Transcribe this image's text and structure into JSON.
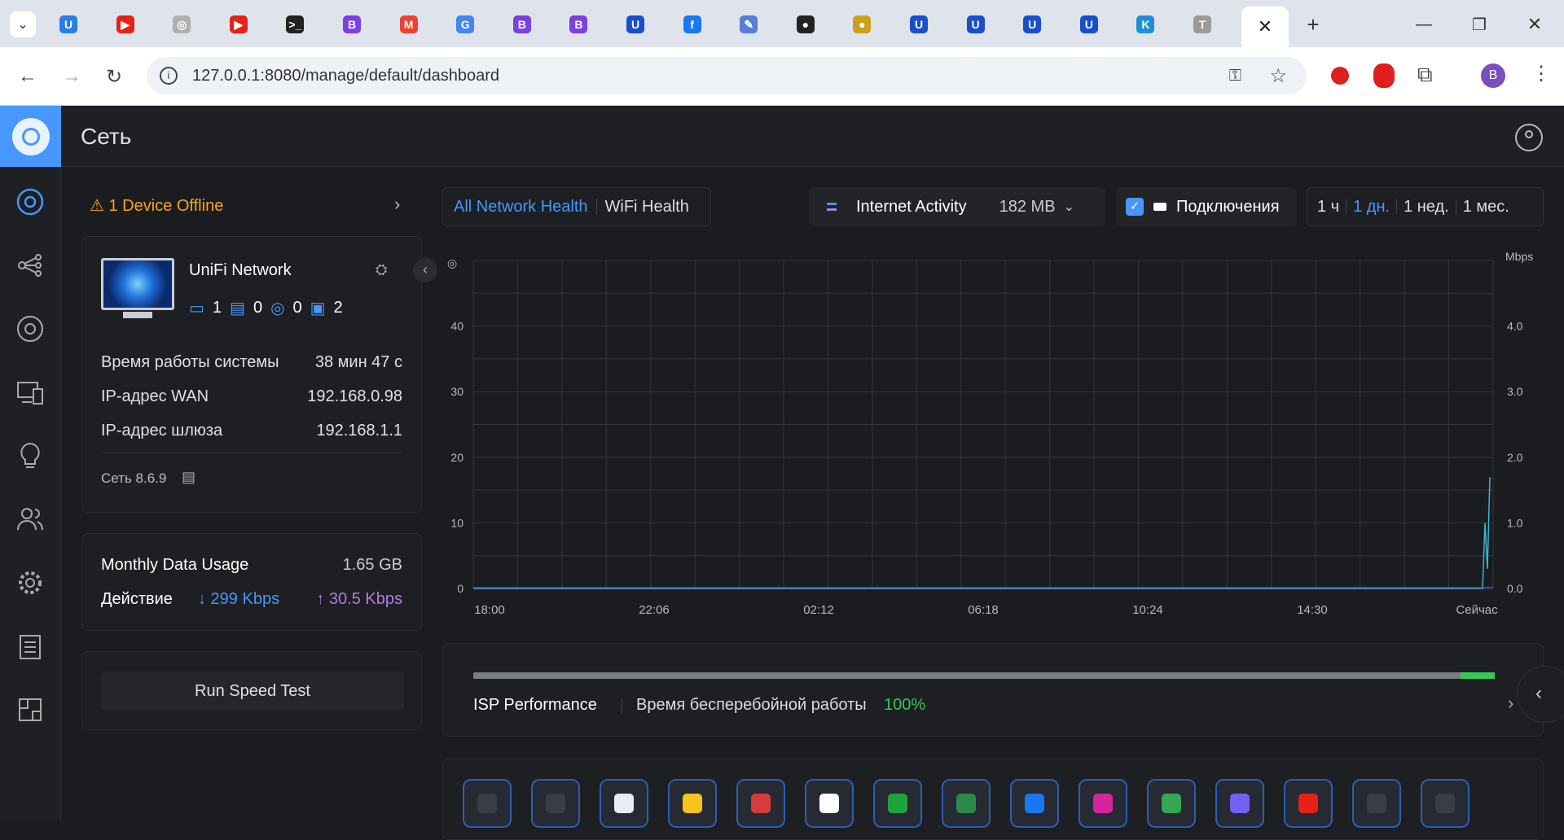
{
  "browser": {
    "url": "127.0.0.1:8080/manage/default/dashboard",
    "profile": "B"
  },
  "tabs": [
    {
      "c": "#2b7de9",
      "t": "U"
    },
    {
      "c": "#e62117",
      "t": "▶"
    },
    {
      "c": "#b0b0b0",
      "t": "◎"
    },
    {
      "c": "#e62117",
      "t": "▶"
    },
    {
      "c": "#222",
      "t": ">_"
    },
    {
      "c": "#7b3fe4",
      "t": "B"
    },
    {
      "c": "#ea4335",
      "t": "M"
    },
    {
      "c": "#4285f4",
      "t": "G"
    },
    {
      "c": "#7b3fe4",
      "t": "B"
    },
    {
      "c": "#7b3fe4",
      "t": "B"
    },
    {
      "c": "#1a4fc9",
      "t": "U"
    },
    {
      "c": "#1877f2",
      "t": "f"
    },
    {
      "c": "#5a7bd6",
      "t": "✎"
    },
    {
      "c": "#222",
      "t": "●"
    },
    {
      "c": "#c9a21a",
      "t": "●"
    },
    {
      "c": "#1a4fc9",
      "t": "U"
    },
    {
      "c": "#1a4fc9",
      "t": "U"
    },
    {
      "c": "#1a4fc9",
      "t": "U"
    },
    {
      "c": "#1a4fc9",
      "t": "U"
    },
    {
      "c": "#1f8fd4",
      "t": "K"
    },
    {
      "c": "#9a9a9a",
      "t": "T"
    }
  ],
  "header": {
    "title": "Сеть"
  },
  "alert": {
    "text": "1 Device Offline"
  },
  "device": {
    "name": "UniFi Network",
    "counts": [
      "1",
      "0",
      "0",
      "2"
    ]
  },
  "stats": {
    "uptime_label": "Время работы системы",
    "uptime": "38 мин 47 с",
    "wan_label": "IP-адрес WAN",
    "wan": "192.168.0.98",
    "gw_label": "IP-адрес шлюза",
    "gw": "192.168.1.1",
    "version": "Сеть 8.6.9"
  },
  "usage": {
    "label": "Monthly Data Usage",
    "value": "1.65 GB",
    "activity_label": "Действие",
    "down": "↓ 299 Kbps",
    "up": "↑ 30.5 Kbps"
  },
  "speedtest": {
    "label": "Run Speed Test"
  },
  "health_tabs": {
    "all": "All Network Health",
    "wifi": "WiFi Health"
  },
  "activity": {
    "label": "Internet Activity",
    "value": "182 MB",
    "connections": "Подключения"
  },
  "ranges": [
    "1 ч",
    "1 дн.",
    "1 нед.",
    "1 мес."
  ],
  "isp": {
    "label": "ISP Performance",
    "uptime_label": "Время бесперебойной работы",
    "uptime": "100%"
  },
  "chart_data": {
    "type": "line",
    "x_ticks": [
      "18:00",
      "22:06",
      "02:12",
      "06:18",
      "10:24",
      "14:30",
      "Сейчас"
    ],
    "y_left_ticks": [
      "0",
      "10",
      "20",
      "30",
      "40"
    ],
    "y_right_ticks": [
      "0.0",
      "1.0",
      "2.0",
      "3.0",
      "4.0"
    ],
    "ylabel_right": "Mbps",
    "series": [
      {
        "values": [
          0,
          0,
          0,
          0,
          0,
          0,
          0,
          0,
          0,
          0,
          1.0,
          0.3,
          1.7
        ]
      }
    ],
    "grid": true
  }
}
